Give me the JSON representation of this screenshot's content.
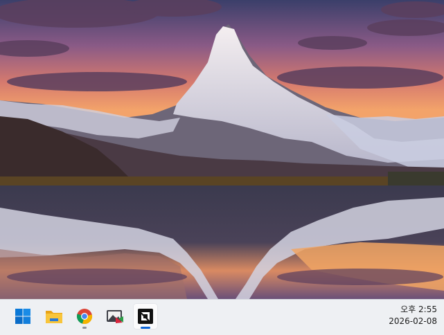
{
  "wallpaper": {
    "description": "mountain-reflection-sunset",
    "sky_top": "#3a3f66",
    "sky_glow": "#f08a4c",
    "lake": "#2c2c3e"
  },
  "taskbar": {
    "background": "#eef0f3",
    "apps": [
      {
        "name": "start",
        "icon": "windows-start-icon",
        "active": false,
        "running": false
      },
      {
        "name": "file-explorer",
        "icon": "folder-icon",
        "active": false,
        "running": false
      },
      {
        "name": "chrome",
        "icon": "chrome-icon",
        "active": false,
        "running": true
      },
      {
        "name": "photo-app",
        "icon": "image-app-icon",
        "active": false,
        "running": false
      },
      {
        "name": "amd-software",
        "icon": "amd-icon",
        "active": true,
        "running": true
      }
    ]
  },
  "clock": {
    "time": "오후 2:55",
    "date": "2026-02-08"
  }
}
